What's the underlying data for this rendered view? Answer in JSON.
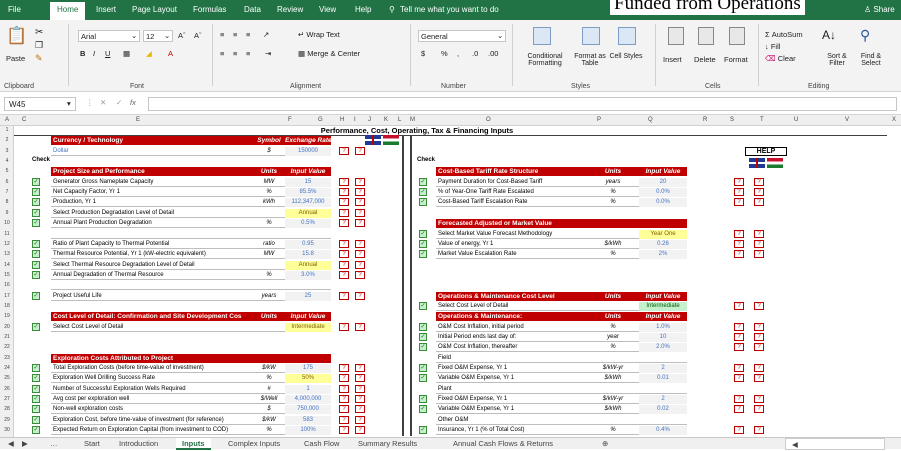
{
  "title_overlay": "Funded from Operations",
  "menu": {
    "tabs": [
      "File",
      "Home",
      "Insert",
      "Page Layout",
      "Formulas",
      "Data",
      "Review",
      "View",
      "Help"
    ],
    "tellme": "Tell me what you want to do",
    "share": "Share"
  },
  "ribbon": {
    "paste": "Paste",
    "font_name": "Arial",
    "font_size": "12",
    "wrap_text": "Wrap Text",
    "merge_center": "Merge & Center",
    "number_format": "General",
    "conditional_formatting": "Conditional Formatting",
    "format_as_table": "Format as Table",
    "cell_styles": "Cell Styles",
    "insert": "Insert",
    "delete": "Delete",
    "format": "Format",
    "autosum": "AutoSum",
    "fill": "Fill",
    "clear": "Clear",
    "sort_filter": "Sort & Filter",
    "find_select": "Find & Select",
    "groups": [
      "Clipboard",
      "Font",
      "Alignment",
      "Number",
      "Styles",
      "Cells",
      "Editing"
    ]
  },
  "formula_bar": {
    "name_box": "W45",
    "fx": "fx",
    "content": ""
  },
  "columns": [
    "A",
    "C",
    "E",
    "F",
    "G",
    "H",
    "I",
    "J",
    "K",
    "L",
    "M",
    "O",
    "P",
    "Q",
    "R",
    "S",
    "T",
    "U",
    "V",
    "X"
  ],
  "rows": [
    "1",
    "2",
    "3",
    "4",
    "5",
    "6",
    "7",
    "8",
    "9",
    "10",
    "11",
    "12",
    "13",
    "14",
    "15",
    "16",
    "17",
    "18",
    "19",
    "20",
    "21",
    "22",
    "23",
    "24",
    "25",
    "26",
    "27",
    "28",
    "29",
    "30"
  ],
  "sheet": {
    "banner": "Performance, Cost, Operating, Tax & Financing Inputs",
    "check": "Check",
    "help": "HELP",
    "currency": {
      "title": "Currency / Technology",
      "u": "Symbol",
      "v": "Exchange Rate",
      "item": "Dollar",
      "sym": "$",
      "rate": "150000"
    },
    "left_sections": [
      {
        "title": "Project Size and Performance",
        "u": "Units",
        "v": "Input Value",
        "rows": [
          {
            "l": "Generator Gross Nameplate Capacity",
            "u": "MW",
            "v": "15"
          },
          {
            "l": "Net Capacity Factor, Yr 1",
            "u": "%",
            "v": "85.5%"
          },
          {
            "l": "Production, Yr 1",
            "u": "kWh",
            "v": "112,347,000"
          },
          {
            "l": "Select Production Degradation Level of Detail",
            "u": "",
            "v": "Annual",
            "t": "y"
          },
          {
            "l": "Annual Plant Production Degradation",
            "u": "%",
            "v": "0.5%"
          },
          {
            "l": "",
            "u": "",
            "v": ""
          },
          {
            "l": "Ratio of Plant Capacity to Thermal Potential",
            "u": "ratio",
            "v": "0.95"
          },
          {
            "l": "Thermal Resource Potential, Yr 1 (kW-electric equivalent)",
            "u": "MW",
            "v": "15.8"
          },
          {
            "l": "Select Thermal Resource Degradation Level of Detail",
            "u": "",
            "v": "Annual",
            "t": "y"
          },
          {
            "l": "Annual Degradation of Thermal Resource",
            "u": "%",
            "v": "3.0%"
          },
          {
            "l": "",
            "u": "",
            "v": ""
          },
          {
            "l": "Project Useful Life",
            "u": "years",
            "v": "25"
          }
        ]
      },
      {
        "title": "Cost Level of Detail: Confirmation and Site Development Cos",
        "u": "Units",
        "v": "Input Value",
        "rows": [
          {
            "l": "Select Cost Level of Detail",
            "u": "",
            "v": "Intermediate",
            "t": "y"
          }
        ]
      },
      {
        "title": "Exploration Costs Attributed to Project",
        "u": "",
        "v": "",
        "rows": [
          {
            "l": "Total Exploration Costs (before time-value of investment)",
            "u": "$/kW",
            "v": "175"
          },
          {
            "l": "Exploration Well Drilling Success Rate",
            "u": "%",
            "v": "50%",
            "t": "y"
          },
          {
            "l": "Number of Successful Exploration Wells Required",
            "u": "#",
            "v": "1"
          },
          {
            "l": "Avg cost per exploration well",
            "u": "$/Well",
            "v": "4,000,000"
          },
          {
            "l": "Non-well exploration costs",
            "u": "$",
            "v": "750,000"
          },
          {
            "l": "Exploration Cost, before time-value of investment (for reference)",
            "u": "$/kW",
            "v": "583"
          },
          {
            "l": "Expected Return on Exploration Capital (from investment to COD)",
            "u": "%",
            "v": "100%"
          }
        ]
      }
    ],
    "right_sections": [
      {
        "title": "Cost-Based Tariff Rate Structure",
        "u": "Units",
        "v": "Input Value",
        "rows": [
          {
            "l": "Payment Duration for Cost-Based Tariff",
            "u": "years",
            "v": "20"
          },
          {
            "l": "% of Year-One Tariff Rate Escalated",
            "u": "%",
            "v": "0.0%"
          },
          {
            "l": "Cost-Based Tariff Escalation Rate",
            "u": "%",
            "v": "0.0%"
          }
        ]
      },
      {
        "title": "Forecasted Adjusted or Market Value",
        "u": "",
        "v": "",
        "rows": [
          {
            "l": "Select Market Value Forecast Methodology",
            "u": "",
            "v": "Year One",
            "t": "y"
          },
          {
            "l": "Value of energy, Yr 1",
            "u": "$/kWh",
            "v": "0.26"
          },
          {
            "l": "Market Value Escalation Rate",
            "u": "%",
            "v": "2%"
          }
        ]
      },
      {
        "title": "Operations & Maintenance Cost Level",
        "u": "Units",
        "v": "Input Value",
        "rows": [
          {
            "l": "Select Cost Level of Detail",
            "u": "",
            "v": "Intermediate",
            "t": "g"
          }
        ]
      },
      {
        "title": "Operations & Maintenance:",
        "u": "Units",
        "v": "Input Value",
        "rows": [
          {
            "l": "O&M Cost Inflation, initial period",
            "u": "%",
            "v": "1.0%"
          },
          {
            "l": "Initial Period ends last day of:",
            "u": "year",
            "v": "10"
          },
          {
            "l": "O&M Cost Inflation, thereafter",
            "u": "%",
            "v": "2.0%"
          },
          {
            "l": "Field",
            "u": "",
            "v": ""
          },
          {
            "l": "Fixed O&M Expense, Yr 1",
            "u": "$/kW-yr",
            "v": "2"
          },
          {
            "l": "Variable O&M Expense, Yr 1",
            "u": "$/kWh",
            "v": "0.01"
          },
          {
            "l": "Plant",
            "u": "",
            "v": ""
          },
          {
            "l": "Fixed O&M Expense, Yr 1",
            "u": "$/kW-yr",
            "v": "2"
          },
          {
            "l": "Variable O&M Expense, Yr 1",
            "u": "$/kWh",
            "v": "0.02"
          },
          {
            "l": "Other O&M",
            "u": "",
            "v": ""
          },
          {
            "l": "Insurance, Yr 1 (% of Total Cost)",
            "u": "%",
            "v": "0.4%"
          }
        ]
      }
    ],
    "q_mark": "?"
  },
  "sheet_tabs": [
    "Start",
    "Introduction",
    "Inputs",
    "Complex Inputs",
    "Cash Flow",
    "Summary Results",
    "Annual Cash Flows & Returns"
  ],
  "active_tab": "Inputs"
}
